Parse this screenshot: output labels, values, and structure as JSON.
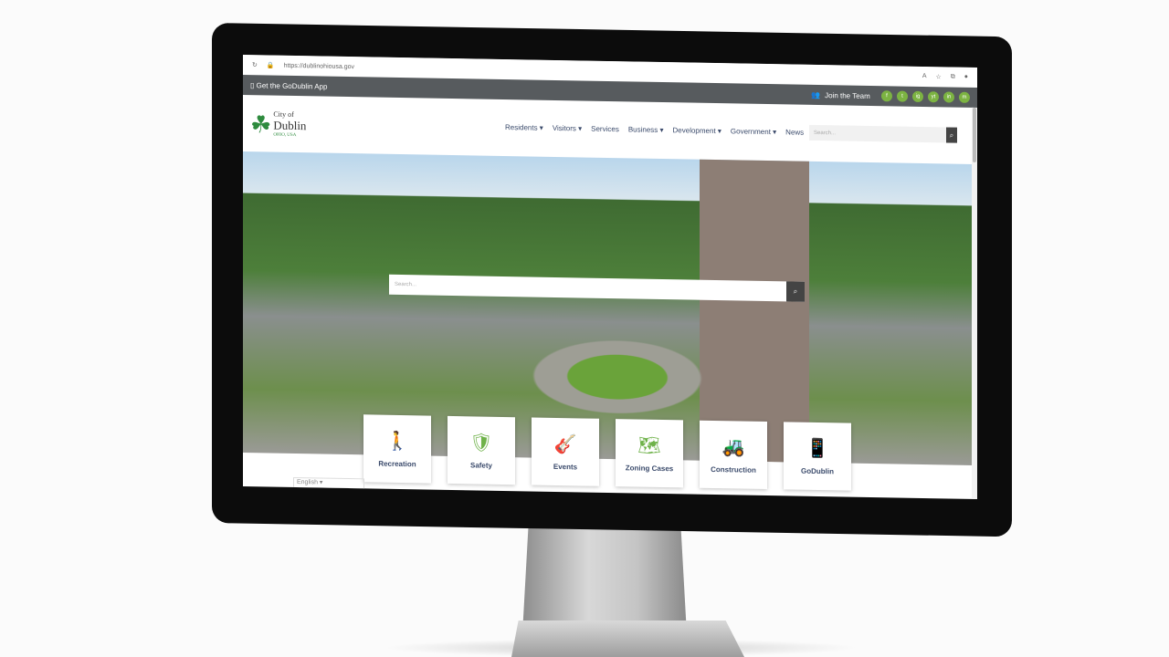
{
  "browser": {
    "url": "https://dublinohiousa.gov",
    "reload_icon": "reload-icon",
    "lock_icon": "lock-icon"
  },
  "topbar": {
    "app_label": "Get the GoDublin App",
    "join_label": "Join the Team",
    "social": [
      "f",
      "t",
      "ig",
      "yt",
      "in",
      "m"
    ]
  },
  "logo": {
    "line1": "City of",
    "line2": "Dublin",
    "line3": "OHIO, USA"
  },
  "nav": [
    "Residents ▾",
    "Visitors ▾",
    "Services",
    "Business ▾",
    "Development ▾",
    "Government ▾",
    "News"
  ],
  "header_search": {
    "placeholder": "Search..."
  },
  "hero_search": {
    "placeholder": "Search..."
  },
  "tiles": [
    {
      "label": "Recreation",
      "icon": "🚶"
    },
    {
      "label": "Safety",
      "icon": "🛡"
    },
    {
      "label": "Events",
      "icon": "🎸"
    },
    {
      "label": "Zoning Cases",
      "icon": "🗺"
    },
    {
      "label": "Construction",
      "icon": "🚜"
    },
    {
      "label": "GoDublin",
      "icon": "📱"
    }
  ],
  "language": "English",
  "colors": {
    "accent": "#7cb342",
    "topbar": "#575b5e",
    "nav_text": "#3a4a6b"
  }
}
